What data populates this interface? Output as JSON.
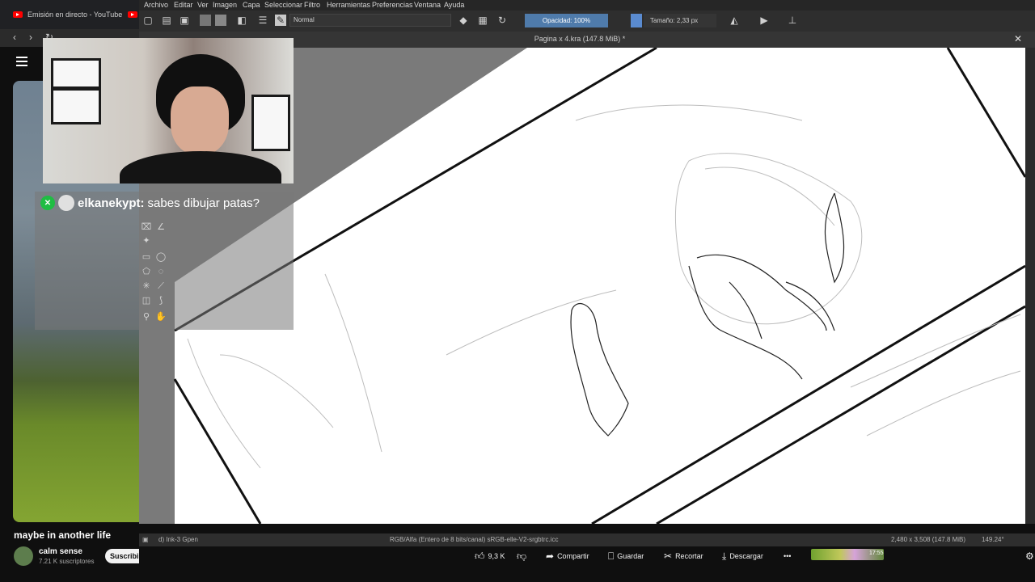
{
  "browser": {
    "tab_title": "Emisión en directo - YouTube",
    "nav_back": "‹",
    "nav_forward": "›",
    "nav_reload": "↻"
  },
  "krita": {
    "menu": [
      "Archivo",
      "Editar",
      "Ver",
      "Imagen",
      "Capa",
      "Seleccionar",
      "Filtro",
      "Herramientas",
      "Preferencias",
      "Ventana",
      "Ayuda"
    ],
    "blend_mode": "Normal",
    "opacity": "Opacidad: 100%",
    "size": "Tamaño: 2,33 px",
    "document_title": "Pagina x 4.kra (147.8 MiB) *",
    "status": {
      "brush": "d) Ink-3 Gpen",
      "color_space": "RGB/Alfa (Entero de 8 bits/canal)  sRGB-elle-V2-srgbtrc.icc",
      "dimensions": "2,480 x 3,508 (147.8 MiB)",
      "rotation": "149.24°"
    }
  },
  "chat": {
    "badge_icon": "x-badge-icon",
    "username": "elkanekypt:",
    "message": "sabes dibujar patas?"
  },
  "video": {
    "title": "maybe in another life",
    "channel": "calm sense",
    "subscribers": "7.21 K suscriptores",
    "subscribe_label": "Suscribirme",
    "likes": "9,3 K",
    "share": "Compartir",
    "save": "Guardar",
    "clip": "Recortar",
    "download": "Descargar",
    "more": "•••",
    "mini_time": "17:55"
  },
  "colors": {
    "accent": "#4f7bab",
    "chat_badge": "#1fbd43",
    "yt_red": "#ff0000"
  }
}
